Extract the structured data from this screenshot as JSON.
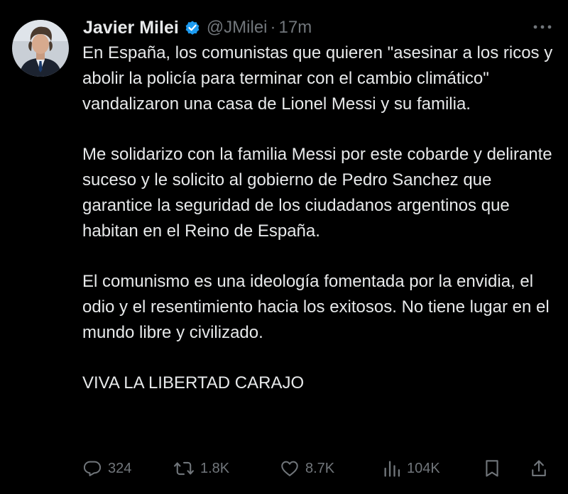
{
  "author": {
    "display_name": "Javier Milei",
    "handle": "@JMilei",
    "separator": "·",
    "time": "17m",
    "verified_color": "#1d9bf0"
  },
  "tweet": {
    "paragraphs": [
      "En España, los comunistas que quieren \"asesinar a los ricos y abolir la policía para terminar con el cambio climático\" vandalizaron una casa de Lionel Messi y su familia.",
      "Me solidarizo con la familia Messi por este cobarde y delirante suceso y le solicito al gobierno de Pedro Sanchez que garantice la seguridad de los ciudadanos argentinos que habitan en el Reino de España.",
      "El comunismo es una ideología fomentada por la envidia, el odio y el resentimiento hacia los exitosos. No tiene lugar en el mundo libre y civilizado.",
      "VIVA LA LIBERTAD CARAJO"
    ]
  },
  "actions": {
    "reply_count": "324",
    "retweet_count": "1.8K",
    "like_count": "8.7K",
    "views_count": "104K"
  },
  "icons": {
    "more": "more-horizontal-icon",
    "reply": "comment-icon",
    "retweet": "retweet-icon",
    "like": "heart-icon",
    "views": "bar-chart-icon",
    "bookmark": "bookmark-icon",
    "share": "share-icon"
  },
  "colors": {
    "background": "#000000",
    "text": "#e7e9ea",
    "muted": "#71767b",
    "verified": "#1d9bf0"
  }
}
